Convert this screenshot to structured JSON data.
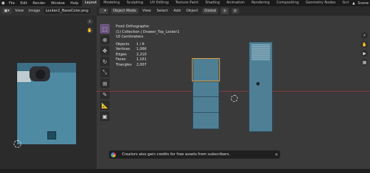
{
  "topbar": {
    "logo_icon": "blender-icon",
    "menus": [
      "File",
      "Edit",
      "Render",
      "Window",
      "Help"
    ],
    "workspaces": [
      "Layout",
      "Modeling",
      "Sculpting",
      "UV Editing",
      "Texture Paint",
      "Shading",
      "Animation",
      "Rendering",
      "Compositing",
      "Geometry Nodes",
      "Scripting"
    ],
    "active_workspace": "Layout",
    "scene_label": "Scene"
  },
  "image_editor": {
    "view_label": "View",
    "image_label": "Image",
    "image_name": "Locker2_BaseColor.png"
  },
  "viewport": {
    "mode": "Object Mode",
    "menus": [
      "View",
      "Select",
      "Add",
      "Object"
    ],
    "orientation": "Global",
    "info": {
      "view_name": "Front Orthographic",
      "collection_line": "(1) Collection | Drawer_Top_Locker1",
      "scale_line": "10 Centimeters",
      "stats": [
        {
          "label": "Objects",
          "value": "1 / 6"
        },
        {
          "label": "Vertices",
          "value": "1,066"
        },
        {
          "label": "Edges",
          "value": "2,210"
        },
        {
          "label": "Faces",
          "value": "1,161"
        },
        {
          "label": "Triangles",
          "value": "2,007"
        }
      ]
    },
    "toast_text": "Creators also gain credits for free assets from subscribers.",
    "toast_close": "✕"
  }
}
